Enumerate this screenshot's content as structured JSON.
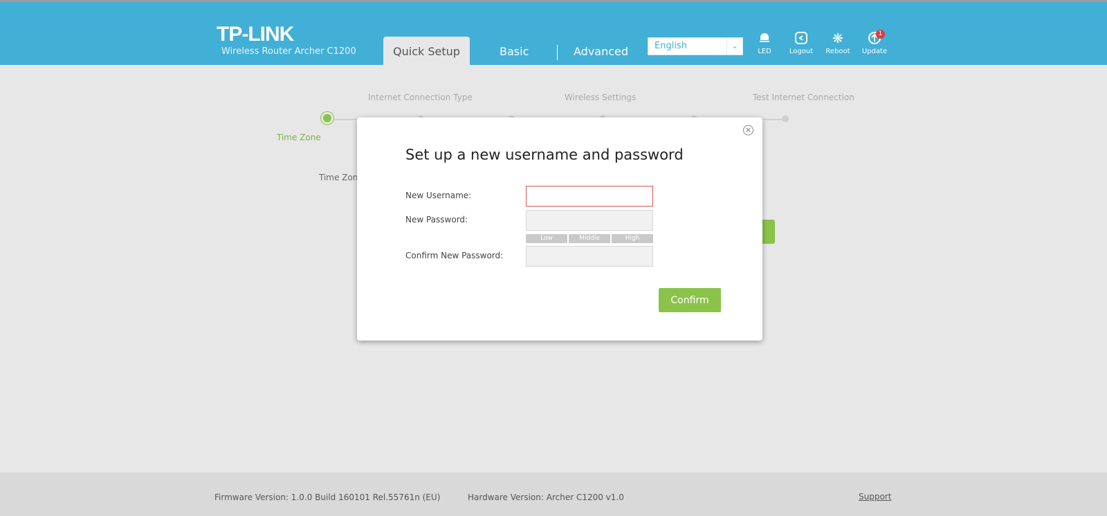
{
  "header": {
    "logo": "TP-LINK",
    "model": "Wireless Router Archer C1200",
    "tabs": {
      "quick_setup": "Quick Setup",
      "basic": "Basic",
      "advanced": "Advanced"
    },
    "language": {
      "selected": "English"
    },
    "icons": [
      {
        "name": "led-icon",
        "label": "LED"
      },
      {
        "name": "logout-icon",
        "label": "Logout"
      },
      {
        "name": "reboot-icon",
        "label": "Reboot"
      },
      {
        "name": "update-icon",
        "label": "Update",
        "badge": "1"
      }
    ]
  },
  "steps": {
    "labels": [
      "Time Zone",
      "Internet Connection Type",
      "Wireless Settings",
      "Test Internet Connection"
    ],
    "active_index": 0,
    "time_zone_field_label": "Time Zon"
  },
  "modal": {
    "title": "Set up a new username and password",
    "fields": {
      "username_label": "New Username:",
      "username_value": "",
      "password_label": "New Password:",
      "password_value": "",
      "confirm_label": "Confirm New Password:",
      "confirm_value": ""
    },
    "strength": [
      "Low",
      "Middle",
      "High"
    ],
    "confirm_button": "Confirm"
  },
  "footer": {
    "firmware": "Firmware Version: 1.0.0 Build 160101 Rel.55761n (EU)",
    "hardware": "Hardware Version: Archer C1200 v1.0",
    "support": "Support"
  },
  "colors": {
    "header_bg": "#42afd6",
    "accent_green": "#8bc34a",
    "error_red": "#d9534f",
    "badge_red": "#e23b3b"
  }
}
